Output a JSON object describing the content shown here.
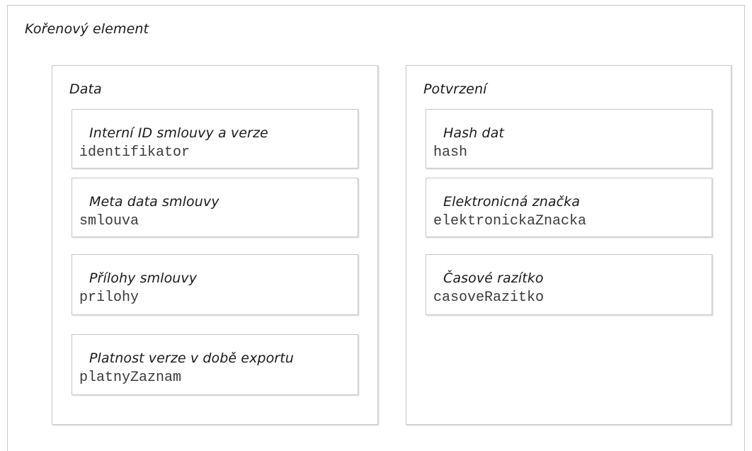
{
  "root": {
    "title": "Kořenový element"
  },
  "data_group": {
    "title": "Data",
    "items": [
      {
        "label": "Interní ID smlouvy a verze",
        "element": "identifikator"
      },
      {
        "label": "Meta data smlouvy",
        "element": "smlouva"
      },
      {
        "label": "Přílohy smlouvy",
        "element": "prilohy"
      },
      {
        "label": "Platnost verze v době exportu",
        "element": "platnyZaznam"
      }
    ]
  },
  "confirm_group": {
    "title": "Potvrzení",
    "items": [
      {
        "label": "Hash dat",
        "element": "hash"
      },
      {
        "label": "Elektronicná značka",
        "element": "elektronickaZnacka"
      },
      {
        "label": "Časové razítko",
        "element": "casoveRazitko"
      }
    ]
  }
}
